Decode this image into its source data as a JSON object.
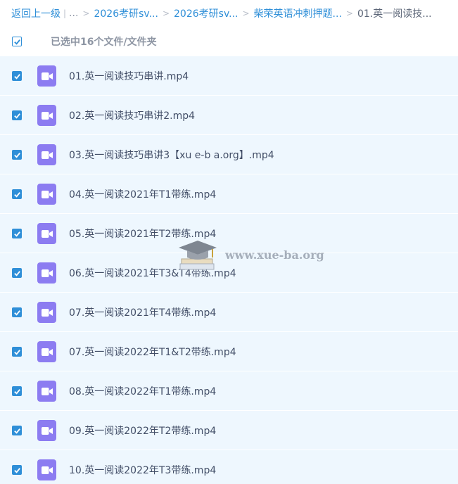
{
  "breadcrumb": {
    "back": "返回上一级",
    "sep_bar": "|",
    "ellipsis": "...",
    "items": [
      "2026考研sv...",
      "2026考研sv...",
      "柴荣英语冲刺押题...",
      "01.英一阅读技..."
    ]
  },
  "selection": {
    "label": "已选中16个文件/文件夹"
  },
  "files": [
    {
      "name": "01.英一阅读技巧串讲.mp4"
    },
    {
      "name": "02.英一阅读技巧串讲2.mp4"
    },
    {
      "name": "03.英一阅读技巧串讲3【xu e-b a.org】.mp4"
    },
    {
      "name": "04.英一阅读2021年T1带练.mp4"
    },
    {
      "name": "05.英一阅读2021年T2带练.mp4"
    },
    {
      "name": "06.英一阅读2021年T3&T4带练.mp4"
    },
    {
      "name": "07.英一阅读2021年T4带练.mp4"
    },
    {
      "name": "07.英一阅读2022年T1&T2带练.mp4"
    },
    {
      "name": "08.英一阅读2022年T1带练.mp4"
    },
    {
      "name": "09.英一阅读2022年T2带练.mp4"
    },
    {
      "name": "10.英一阅读2022年T3带练.mp4"
    }
  ],
  "watermark": {
    "text": "www.xue-ba.org"
  },
  "colors": {
    "accent": "#2f8fd8",
    "row_bg": "#eef7fe",
    "video_icon": "#8c7cf1"
  }
}
